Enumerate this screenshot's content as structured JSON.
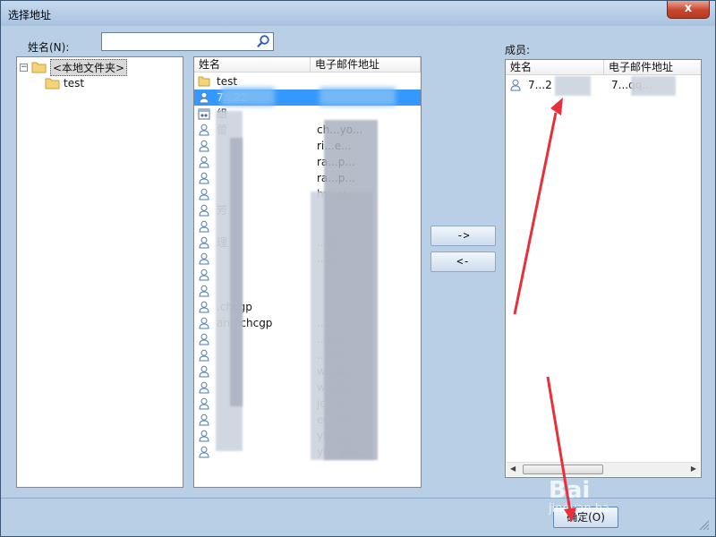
{
  "window": {
    "title": "选择地址",
    "close_label": "x"
  },
  "search": {
    "label": "姓名(N):",
    "value": "",
    "placeholder": ""
  },
  "tree": {
    "items": [
      {
        "label": "<本地文件夹>",
        "expander": "−",
        "selected": true
      },
      {
        "label": "test",
        "selected": false
      }
    ]
  },
  "contacts": {
    "columns": [
      "姓名",
      "电子邮件地址"
    ],
    "rows": [
      {
        "icon": "folder-icon",
        "name": "test",
        "email": ""
      },
      {
        "icon": "contact-icon",
        "name": "7...22",
        "email": "",
        "selected": true
      },
      {
        "icon": "group-icon",
        "name": "组",
        "email": ""
      },
      {
        "icon": "contact-icon",
        "name": "蕾",
        "email": "ch...yo..."
      },
      {
        "icon": "contact-icon",
        "name": "",
        "email": "ri...e..."
      },
      {
        "icon": "contact-icon",
        "name": "",
        "email": "ra...p..."
      },
      {
        "icon": "contact-icon",
        "name": "",
        "email": "ra...p..."
      },
      {
        "icon": "contact-icon",
        "name": "",
        "email": "hy...u..."
      },
      {
        "icon": "contact-icon",
        "name": "芳",
        "email": ""
      },
      {
        "icon": "contact-icon",
        "name": "",
        "email": ""
      },
      {
        "icon": "contact-icon",
        "name": "理",
        "email": "...o..."
      },
      {
        "icon": "contact-icon",
        "name": "",
        "email": "...u..."
      },
      {
        "icon": "contact-icon",
        "name": "",
        "email": ""
      },
      {
        "icon": "contact-icon",
        "name": "",
        "email": ""
      },
      {
        "icon": "contact-icon",
        "name": ".chcgp",
        "email": ""
      },
      {
        "icon": "contact-icon",
        "name": "ang.chcgp",
        "email": "...c..."
      },
      {
        "icon": "contact-icon",
        "name": "",
        "email": "...ou..."
      },
      {
        "icon": "contact-icon",
        "name": "",
        "email": "...ou..."
      },
      {
        "icon": "contact-icon",
        "name": "",
        "email": "w...ou..."
      },
      {
        "icon": "contact-icon",
        "name": "",
        "email": "w...ou..."
      },
      {
        "icon": "contact-icon",
        "name": "",
        "email": "jc...y..."
      },
      {
        "icon": "contact-icon",
        "name": "",
        "email": "ec...0c..."
      },
      {
        "icon": "contact-icon",
        "name": "",
        "email": "yh...u..."
      },
      {
        "icon": "contact-icon",
        "name": "",
        "email": "yh...you..."
      }
    ]
  },
  "move": {
    "add_label": "->",
    "remove_label": "<-"
  },
  "members": {
    "label": "成员:",
    "columns": [
      "姓名",
      "电子邮件地址"
    ],
    "rows": [
      {
        "name": "7...2",
        "email": "7...qq..."
      }
    ]
  },
  "ok_label": "确定(O)",
  "watermark": {
    "logo": "Bai",
    "sub": "jingyan.ba"
  },
  "colors": {
    "window_bg": "#b9cfe6",
    "selection": "#3399ff",
    "annotation_arrow": "#e8303a"
  }
}
